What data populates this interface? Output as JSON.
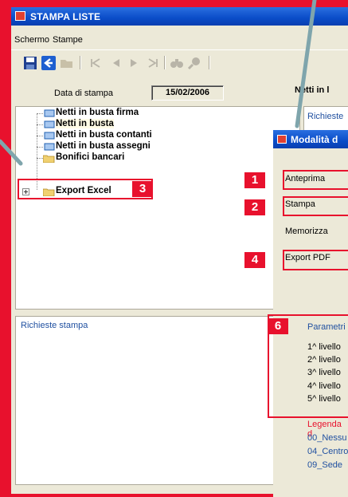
{
  "window": {
    "title": "STAMPA LISTE"
  },
  "menu": {
    "items": [
      "Schermo",
      "Stampe"
    ]
  },
  "form": {
    "date_label": "Data di stampa",
    "date_value": "15/02/2006",
    "right_label": "Netti in l"
  },
  "tree": {
    "items": [
      {
        "label": "Netti in busta firma",
        "icon": "document-icon"
      },
      {
        "label": "Netti in busta",
        "icon": "document-icon"
      },
      {
        "label": "Netti in busta contanti",
        "icon": "document-icon"
      },
      {
        "label": "Netti in busta assegni",
        "icon": "document-icon"
      },
      {
        "label": "Bonifici bancari",
        "icon": "folder-icon"
      },
      {
        "label": "Export Excel",
        "icon": "folder-icon"
      }
    ]
  },
  "panels": {
    "requests_title": "Richieste stampa",
    "right_title": "Richieste"
  },
  "dialog": {
    "title": "Modalità d",
    "buttons": [
      "Anteprima",
      "Stampa",
      "Memorizza",
      "Export PDF"
    ],
    "params_title": "Parametri",
    "levels": [
      "1^ livello",
      "2^ livello",
      "3^ livello",
      "4^ livello",
      "5^ livello"
    ],
    "legend_title": "Legenda d",
    "legend_items": [
      "00_Nessu",
      "04_Centro",
      "09_Sede"
    ]
  },
  "annotations": {
    "badges": [
      "1",
      "2",
      "3",
      "4",
      "6"
    ],
    "accent": "#e8112d",
    "pointer_color": "#7fa5ac"
  }
}
